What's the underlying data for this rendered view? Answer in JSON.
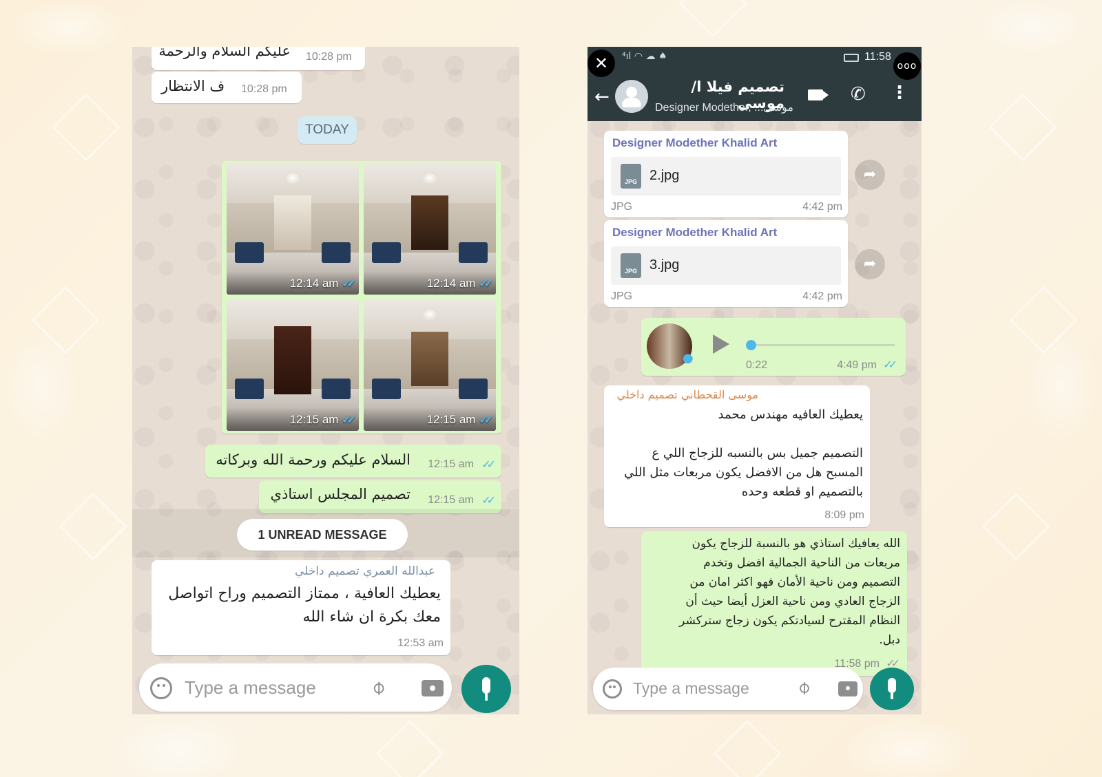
{
  "left": {
    "messages": [
      {
        "text": "عليكم السلام والرحمة",
        "time": "10:28 pm"
      },
      {
        "text": "ف الانتظار",
        "time": "10:28 pm"
      }
    ],
    "date_pill": "TODAY",
    "photos": [
      {
        "time": "12:14 am"
      },
      {
        "time": "12:14 am"
      },
      {
        "time": "12:15 am"
      },
      {
        "time": "12:15 am"
      }
    ],
    "out_messages": [
      {
        "text": "السلام عليكم ورحمة الله وبركاته",
        "time": "12:15 am"
      },
      {
        "text": "تصميم المجلس استاذي",
        "time": "12:15 am"
      }
    ],
    "unread_pill": "1 UNREAD MESSAGE",
    "incoming": {
      "sender": "عبدالله العمري تصميم داخلي",
      "line1": "يعطيك العافية ، ممتاز التصميم وراح اتواصل",
      "line2": "معك بكرة ان شاء الله",
      "time": "12:53 am"
    },
    "input_placeholder": "Type a message"
  },
  "right": {
    "status_bar": {
      "time": "11:58"
    },
    "header": {
      "title": "تصميم فيلا ا/موسى",
      "subtitle": "Designer Modether, ...موسى"
    },
    "files": [
      {
        "sender": "Designer Modether Khalid Art",
        "name": "2.jpg",
        "type": "JPG",
        "time": "4:42 pm"
      },
      {
        "sender": "Designer Modether Khalid Art",
        "name": "3.jpg",
        "type": "JPG",
        "time": "4:42 pm"
      }
    ],
    "voice": {
      "duration": "0:22",
      "time": "4:49 pm",
      "progress": 0
    },
    "incoming": {
      "sender": "موسى القحطاني تصميم داخلي",
      "lines": [
        "يعطيك العافيه مهندس محمد",
        "",
        "التصميم جميل بس بالنسبه للزجاج اللي ع",
        "المسبح هل من الافضل يكون مربعات مثل اللي",
        "بالتصميم او قطعه وحده"
      ],
      "time": "8:09 pm"
    },
    "reply": {
      "lines": [
        "الله يعافيك استاذي هو بالنسبة للزجاج  يكون",
        "مربعات من الناحية الجمالية افضل وتخدم",
        "التصميم ومن ناحية الأمان فهو اكثر امان من",
        "الزجاج العادي ومن ناحية العزل أيضا حيث أن",
        "النظام المقترح لسيادتكم  يكون زجاج ستركشر",
        "دبل."
      ],
      "time": "11:58 pm"
    },
    "input_placeholder": "Type a message"
  },
  "colors": {
    "outgoing_bubble": "#dcf8c6",
    "incoming_bubble": "#ffffff",
    "header": "#2d3b3f",
    "mic_button": "#128c7e",
    "read_ticks": "#4fb6ec",
    "sender_left": "#7a8fa6",
    "sender_right": "#d9874a",
    "file_sender": "#6d72b8"
  }
}
